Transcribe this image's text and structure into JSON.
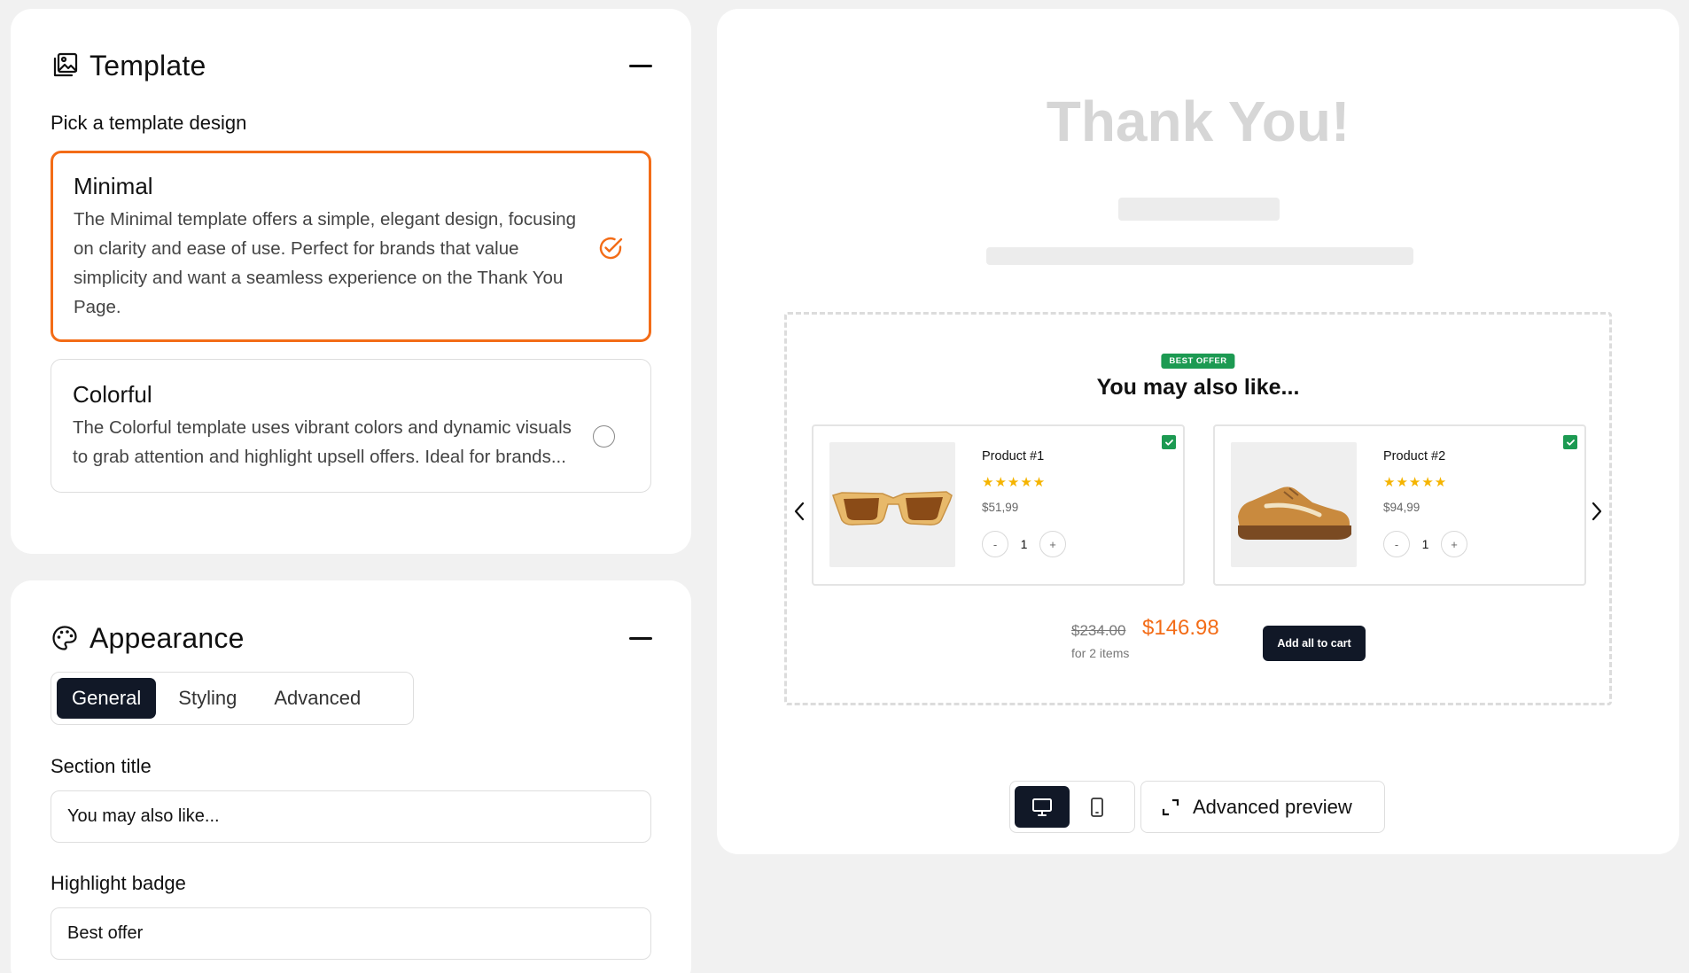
{
  "template": {
    "title": "Template",
    "subtitle": "Pick a template design",
    "options": [
      {
        "title": "Minimal",
        "description": "The Minimal template offers a simple, elegant design, focusing on clarity and ease of use. Perfect for brands that value simplicity and want a seamless experience on the Thank You Page.",
        "selected": true
      },
      {
        "title": "Colorful",
        "description": "The Colorful template uses vibrant colors and dynamic visuals to grab attention and highlight upsell offers. Ideal for brands...",
        "selected": false
      }
    ]
  },
  "appearance": {
    "title": "Appearance",
    "tabs": [
      {
        "label": "General",
        "active": true
      },
      {
        "label": "Styling",
        "active": false
      },
      {
        "label": "Advanced",
        "active": false
      }
    ],
    "section_title_label": "Section title",
    "section_title_value": "You may also like...",
    "highlight_badge_label": "Highlight badge",
    "highlight_badge_value": "Best offer"
  },
  "preview": {
    "thank_you": "Thank You!",
    "badge": "Best offer",
    "upsell_title": "You may also like...",
    "products": [
      {
        "name": "Product #1",
        "price": "$51,99",
        "qty": "1",
        "rating": 5,
        "image": "sunglasses",
        "checked": true
      },
      {
        "name": "Product #2",
        "price": "$94,99",
        "qty": "1",
        "rating": 5,
        "image": "sneaker",
        "checked": true
      }
    ],
    "qty_minus": "-",
    "qty_plus": "+",
    "old_price": "$234.00",
    "new_price": "$146.98",
    "items_note": "for 2 items",
    "add_all_label": "Add all to cart",
    "device_active": "desktop",
    "advanced_preview_label": "Advanced preview"
  },
  "colors": {
    "accent": "#f36c17",
    "dark": "#111827",
    "success": "#1c9a52",
    "star": "#f5b400"
  }
}
